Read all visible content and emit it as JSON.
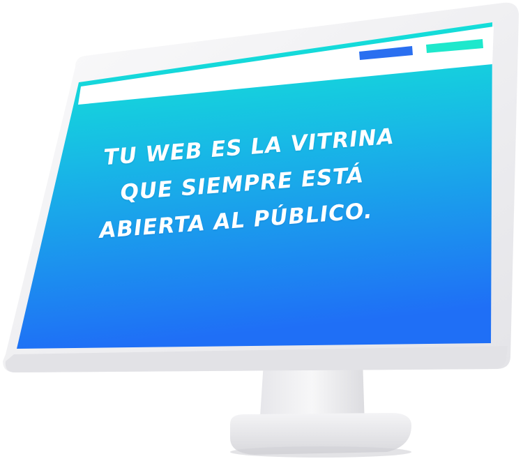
{
  "headline": {
    "line1": "TU WEB ES LA VITRINA",
    "line2": "QUE SIEMPRE ESTÁ",
    "line3": "ABIERTA AL PÚBLICO."
  },
  "colors": {
    "screen_top": "#12f0d2",
    "screen_bottom": "#1f6ff6",
    "button_blue": "#2a6ff0",
    "button_teal": "#1ee8cc",
    "bezel": "#f1f1f3",
    "headline": "#ffffff"
  },
  "icons": {
    "nav_button_1": "blue-bar",
    "nav_button_2": "teal-bar"
  }
}
